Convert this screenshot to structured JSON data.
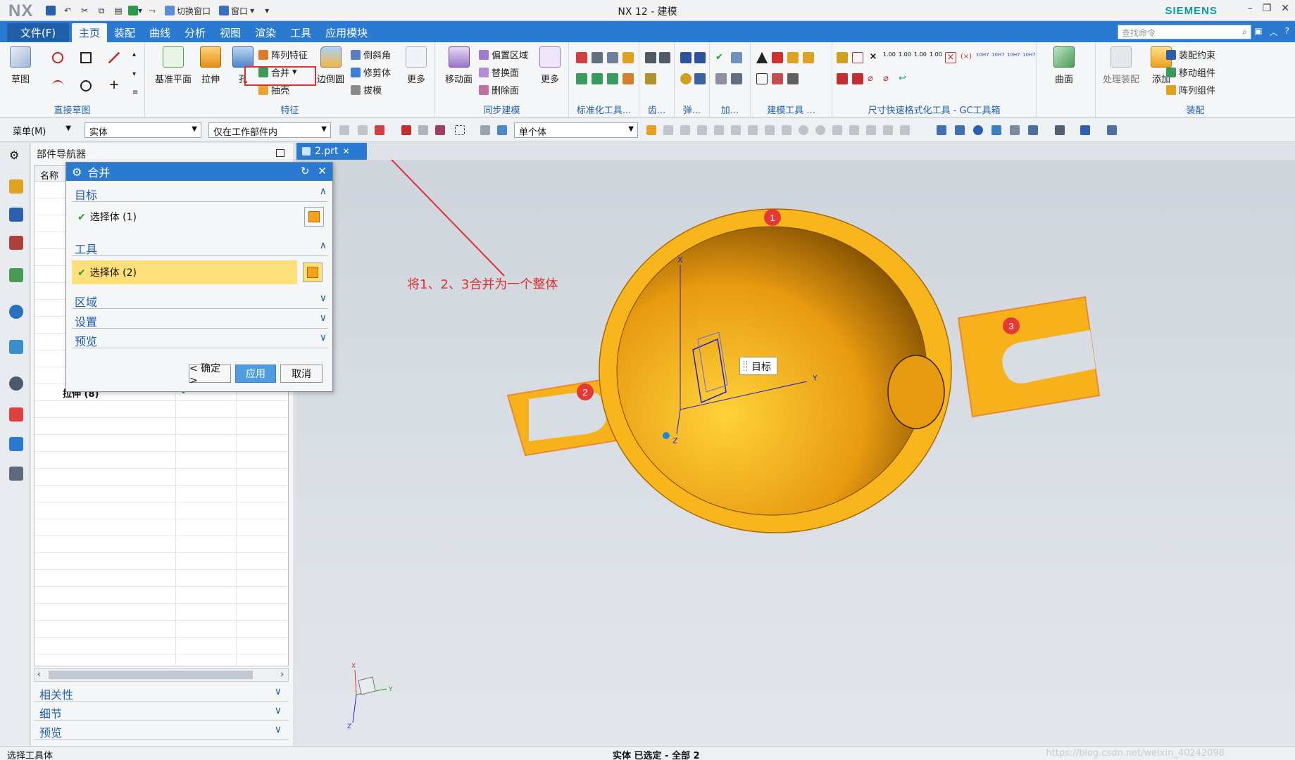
{
  "titlebar": {
    "logo": "NX",
    "title": "NX 12 - 建模",
    "brand": "SIEMENS",
    "switch_window": "切换窗口",
    "window": "窗口",
    "controls": [
      "–",
      "❐",
      "✕"
    ]
  },
  "menubar": {
    "file": "文件(F)",
    "tabs": [
      "主页",
      "装配",
      "曲线",
      "分析",
      "视图",
      "渲染",
      "工具",
      "应用模块"
    ],
    "active_tab": "主页",
    "search_placeholder": "查找命令"
  },
  "ribbon": {
    "sketch": {
      "label": "草图",
      "group": "直接草图"
    },
    "feature": {
      "group": "特征",
      "datum_plane": "基准平面",
      "extrude": "拉伸",
      "hole": "孔",
      "pattern": "阵列特征",
      "unite": "合并",
      "shell": "抽壳",
      "edge_blend": "边倒圆",
      "chamfer": "倒斜角",
      "trim_body": "修剪体",
      "draft": "拔模",
      "more": "更多"
    },
    "sync": {
      "group": "同步建模",
      "move_face": "移动面",
      "offset_region": "偏置区域",
      "replace_face": "替换面",
      "delete_face": "删除面",
      "more": "更多"
    },
    "groups_small": [
      "标准化工具...",
      "齿...",
      "弹...",
      "加...",
      "建模工具 ...",
      "尺寸快速格式化工具 - GC工具箱"
    ],
    "surface": "曲面",
    "assembly": {
      "group": "装配",
      "process": "处理装配",
      "add": "添加",
      "constraint": "装配约束",
      "move_comp": "移动组件",
      "pattern_comp": "阵列组件"
    }
  },
  "toolbar2": {
    "menu": "菜单(M)",
    "filter": "实体",
    "scope": "仅在工作部件内",
    "body_rule": "单个体"
  },
  "navigator": {
    "title": "部件导航器",
    "column": "名称",
    "last_row": "拉伸 (8)",
    "sections": [
      "相关性",
      "细节",
      "预览"
    ]
  },
  "dialog": {
    "title": "合并",
    "target_section": "目标",
    "target_select": "选择体 (1)",
    "tool_section": "工具",
    "tool_select": "选择体 (2)",
    "region": "区域",
    "settings": "设置",
    "preview": "预览",
    "ok": "< 确定 >",
    "apply": "应用",
    "cancel": "取消"
  },
  "viewport": {
    "doc_tab": "2.prt",
    "annotation": "将1、2、3合并为一个整体",
    "tag": "目标",
    "markers": [
      "1",
      "2",
      "3"
    ],
    "axis_x": "X",
    "axis_y": "Y",
    "axis_z": "Z"
  },
  "status": {
    "left": "选择工具体",
    "center": "实体 已选定 - 全部 2",
    "watermark": "https://blog.csdn.net/weixin_40242098"
  },
  "colors": {
    "accent": "#2a7ad1",
    "part": "#f7a21b",
    "highlight": "#e03030"
  }
}
